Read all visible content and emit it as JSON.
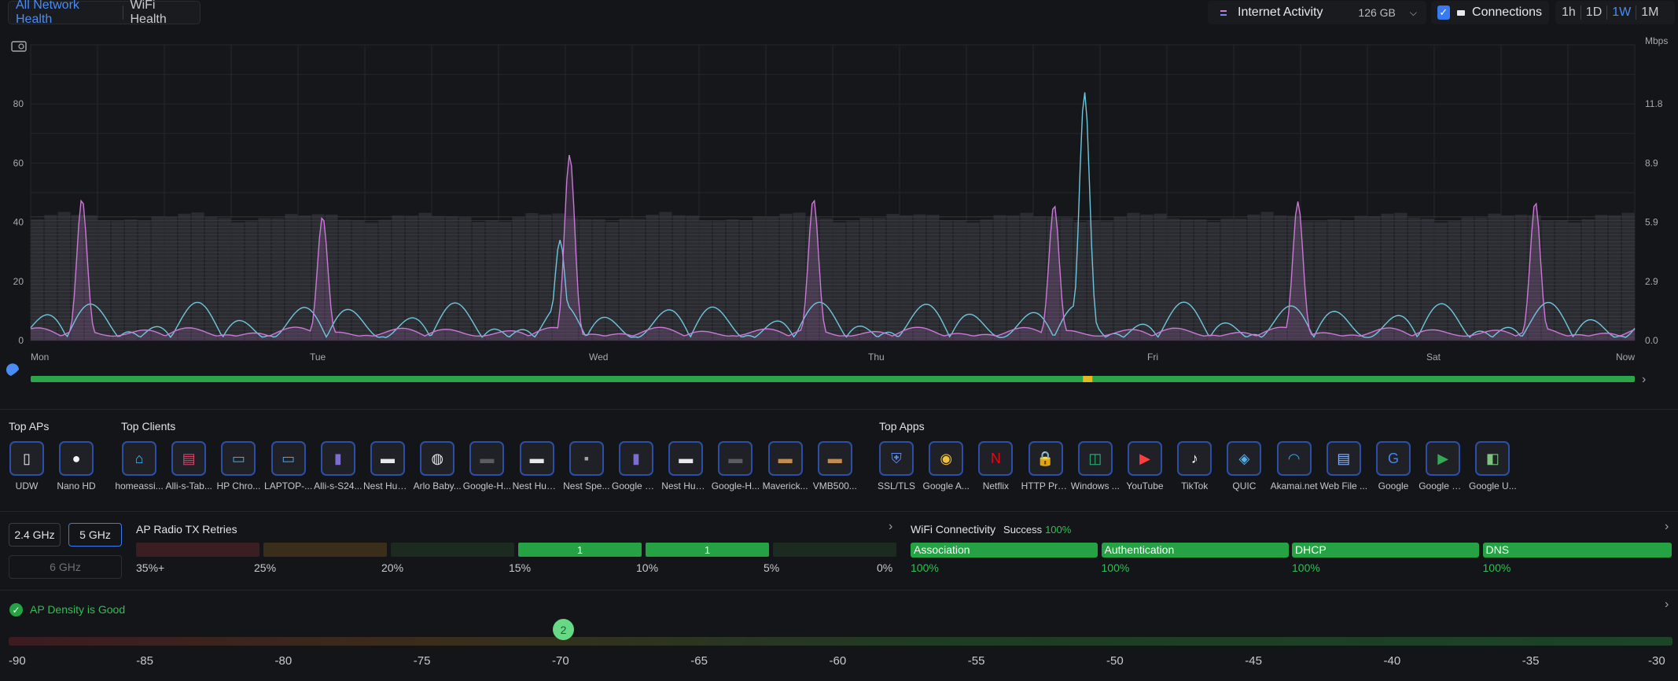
{
  "header": {
    "tabs": [
      {
        "label": "All Network Health",
        "active": true
      },
      {
        "label": "WiFi Health",
        "active": false
      }
    ],
    "activity": {
      "label": "Internet Activity",
      "value": "126 GB"
    },
    "connections": {
      "label": "Connections",
      "checked": true
    },
    "ranges": [
      {
        "label": "1h",
        "active": false
      },
      {
        "label": "1D",
        "active": false
      },
      {
        "label": "1W",
        "active": true
      },
      {
        "label": "1M",
        "active": false
      }
    ]
  },
  "chart_data": {
    "type": "line",
    "left_axis": {
      "ticks": [
        "0",
        "20",
        "40",
        "60",
        "80"
      ],
      "range": [
        0,
        100
      ]
    },
    "right_axis": {
      "unit": "Mbps",
      "ticks": [
        "0.0",
        "2.9",
        "5.9",
        "8.9",
        "11.8"
      ]
    },
    "x_labels": [
      "Mon",
      "Tue",
      "Wed",
      "Thu",
      "Fri",
      "Sat",
      "Now"
    ],
    "colors": {
      "purple": "#c979d6",
      "cyan": "#6fc6dc",
      "bars": "#5a5c62",
      "grid": "#25272c"
    },
    "bar_level": 41,
    "purple_peaks": [
      {
        "x": 0.032,
        "y": 48
      },
      {
        "x": 0.182,
        "y": 42
      },
      {
        "x": 0.336,
        "y": 63
      },
      {
        "x": 0.488,
        "y": 48
      },
      {
        "x": 0.638,
        "y": 46
      },
      {
        "x": 0.79,
        "y": 47
      },
      {
        "x": 0.938,
        "y": 47
      }
    ],
    "cyan_peaks": [
      {
        "x": 0.33,
        "y": 34
      },
      {
        "x": 0.657,
        "y": 84
      }
    ],
    "status_bar": {
      "color": "#2ca44a",
      "warn_color": "#e2b825",
      "warn_at": 0.656
    }
  },
  "top_aps": {
    "title": "Top APs",
    "items": [
      {
        "label": "UDW",
        "icon": "udw-device-icon"
      },
      {
        "label": "Nano HD",
        "icon": "nano-hd-icon"
      }
    ]
  },
  "top_clients": {
    "title": "Top Clients",
    "items": [
      {
        "label": "homeassi...",
        "icon": "home-assistant-icon"
      },
      {
        "label": "Alli-s-Tab...",
        "icon": "tablet-icon"
      },
      {
        "label": "HP Chro...",
        "icon": "laptop-icon"
      },
      {
        "label": "LAPTOP-...",
        "icon": "laptop-icon"
      },
      {
        "label": "Alli-s-S24...",
        "icon": "phone-icon"
      },
      {
        "label": "Nest Hub ...",
        "icon": "nest-hub-icon"
      },
      {
        "label": "Arlo Baby...",
        "icon": "arlo-camera-icon"
      },
      {
        "label": "Google-H...",
        "icon": "google-home-icon"
      },
      {
        "label": "Nest Hub ...",
        "icon": "nest-hub-icon"
      },
      {
        "label": "Nest Spe...",
        "icon": "nest-speaker-icon"
      },
      {
        "label": "Google Pi...",
        "icon": "phone-icon"
      },
      {
        "label": "Nest Hub ...",
        "icon": "nest-hub-icon"
      },
      {
        "label": "Google-H...",
        "icon": "google-home-icon"
      },
      {
        "label": "Maverick...",
        "icon": "device-icon"
      },
      {
        "label": "VMB500...",
        "icon": "device-icon"
      }
    ]
  },
  "top_apps": {
    "title": "Top Apps",
    "items": [
      {
        "label": "SSL/TLS",
        "icon": "shield-icon"
      },
      {
        "label": "Google A...",
        "icon": "chrome-icon"
      },
      {
        "label": "Netflix",
        "icon": "netflix-icon"
      },
      {
        "label": "HTTP Pro...",
        "icon": "lock-icon"
      },
      {
        "label": "Windows ...",
        "icon": "windows-icon"
      },
      {
        "label": "YouTube",
        "icon": "youtube-icon"
      },
      {
        "label": "TikTok",
        "icon": "tiktok-icon"
      },
      {
        "label": "QUIC",
        "icon": "quic-icon"
      },
      {
        "label": "Akamai.net",
        "icon": "akamai-icon"
      },
      {
        "label": "Web File ...",
        "icon": "file-icon"
      },
      {
        "label": "Google",
        "icon": "google-icon"
      },
      {
        "label": "Google Pl...",
        "icon": "google-play-icon"
      },
      {
        "label": "Google U...",
        "icon": "google-update-icon"
      }
    ]
  },
  "bands": {
    "b24": "2.4 GHz",
    "b5": "5 GHz",
    "b6": "6 GHz",
    "selected": "5 GHz"
  },
  "retries": {
    "title": "AP Radio TX Retries",
    "cells": [
      {
        "value": "",
        "color": "#3a1e22"
      },
      {
        "value": "",
        "color": "#3a2e1b"
      },
      {
        "value": "",
        "color": "#1c2b20"
      },
      {
        "value": "1",
        "color": "#25a244"
      },
      {
        "value": "1",
        "color": "#25a244"
      },
      {
        "value": "",
        "color": "#1c2b20"
      }
    ],
    "labels": [
      "35%+",
      "25%",
      "20%",
      "15%",
      "10%",
      "5%",
      "0%"
    ]
  },
  "wifi": {
    "title": "WiFi Connectivity",
    "status": "Success",
    "status_value": "100%",
    "steps": [
      {
        "label": "Association",
        "value": "100%"
      },
      {
        "label": "Authentication",
        "value": "100%"
      },
      {
        "label": "DHCP",
        "value": "100%"
      },
      {
        "label": "DNS",
        "value": "100%"
      }
    ]
  },
  "density": {
    "label": "AP Density is Good",
    "marker": "2",
    "marker_value": -70,
    "ticks": [
      "-90",
      "-85",
      "-80",
      "-75",
      "-70",
      "-65",
      "-60",
      "-55",
      "-50",
      "-45",
      "-40",
      "-35",
      "-30"
    ]
  }
}
